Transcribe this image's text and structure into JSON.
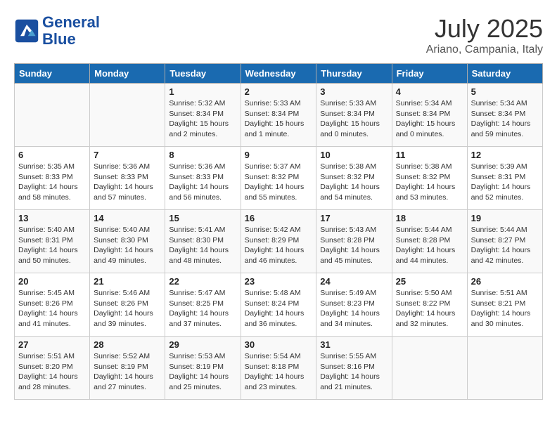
{
  "header": {
    "logo_line1": "General",
    "logo_line2": "Blue",
    "month": "July 2025",
    "location": "Ariano, Campania, Italy"
  },
  "days_of_week": [
    "Sunday",
    "Monday",
    "Tuesday",
    "Wednesday",
    "Thursday",
    "Friday",
    "Saturday"
  ],
  "weeks": [
    [
      {
        "day": "",
        "sunrise": "",
        "sunset": "",
        "daylight": ""
      },
      {
        "day": "",
        "sunrise": "",
        "sunset": "",
        "daylight": ""
      },
      {
        "day": "1",
        "sunrise": "Sunrise: 5:32 AM",
        "sunset": "Sunset: 8:34 PM",
        "daylight": "Daylight: 15 hours and 2 minutes."
      },
      {
        "day": "2",
        "sunrise": "Sunrise: 5:33 AM",
        "sunset": "Sunset: 8:34 PM",
        "daylight": "Daylight: 15 hours and 1 minute."
      },
      {
        "day": "3",
        "sunrise": "Sunrise: 5:33 AM",
        "sunset": "Sunset: 8:34 PM",
        "daylight": "Daylight: 15 hours and 0 minutes."
      },
      {
        "day": "4",
        "sunrise": "Sunrise: 5:34 AM",
        "sunset": "Sunset: 8:34 PM",
        "daylight": "Daylight: 15 hours and 0 minutes."
      },
      {
        "day": "5",
        "sunrise": "Sunrise: 5:34 AM",
        "sunset": "Sunset: 8:34 PM",
        "daylight": "Daylight: 14 hours and 59 minutes."
      }
    ],
    [
      {
        "day": "6",
        "sunrise": "Sunrise: 5:35 AM",
        "sunset": "Sunset: 8:33 PM",
        "daylight": "Daylight: 14 hours and 58 minutes."
      },
      {
        "day": "7",
        "sunrise": "Sunrise: 5:36 AM",
        "sunset": "Sunset: 8:33 PM",
        "daylight": "Daylight: 14 hours and 57 minutes."
      },
      {
        "day": "8",
        "sunrise": "Sunrise: 5:36 AM",
        "sunset": "Sunset: 8:33 PM",
        "daylight": "Daylight: 14 hours and 56 minutes."
      },
      {
        "day": "9",
        "sunrise": "Sunrise: 5:37 AM",
        "sunset": "Sunset: 8:32 PM",
        "daylight": "Daylight: 14 hours and 55 minutes."
      },
      {
        "day": "10",
        "sunrise": "Sunrise: 5:38 AM",
        "sunset": "Sunset: 8:32 PM",
        "daylight": "Daylight: 14 hours and 54 minutes."
      },
      {
        "day": "11",
        "sunrise": "Sunrise: 5:38 AM",
        "sunset": "Sunset: 8:32 PM",
        "daylight": "Daylight: 14 hours and 53 minutes."
      },
      {
        "day": "12",
        "sunrise": "Sunrise: 5:39 AM",
        "sunset": "Sunset: 8:31 PM",
        "daylight": "Daylight: 14 hours and 52 minutes."
      }
    ],
    [
      {
        "day": "13",
        "sunrise": "Sunrise: 5:40 AM",
        "sunset": "Sunset: 8:31 PM",
        "daylight": "Daylight: 14 hours and 50 minutes."
      },
      {
        "day": "14",
        "sunrise": "Sunrise: 5:40 AM",
        "sunset": "Sunset: 8:30 PM",
        "daylight": "Daylight: 14 hours and 49 minutes."
      },
      {
        "day": "15",
        "sunrise": "Sunrise: 5:41 AM",
        "sunset": "Sunset: 8:30 PM",
        "daylight": "Daylight: 14 hours and 48 minutes."
      },
      {
        "day": "16",
        "sunrise": "Sunrise: 5:42 AM",
        "sunset": "Sunset: 8:29 PM",
        "daylight": "Daylight: 14 hours and 46 minutes."
      },
      {
        "day": "17",
        "sunrise": "Sunrise: 5:43 AM",
        "sunset": "Sunset: 8:28 PM",
        "daylight": "Daylight: 14 hours and 45 minutes."
      },
      {
        "day": "18",
        "sunrise": "Sunrise: 5:44 AM",
        "sunset": "Sunset: 8:28 PM",
        "daylight": "Daylight: 14 hours and 44 minutes."
      },
      {
        "day": "19",
        "sunrise": "Sunrise: 5:44 AM",
        "sunset": "Sunset: 8:27 PM",
        "daylight": "Daylight: 14 hours and 42 minutes."
      }
    ],
    [
      {
        "day": "20",
        "sunrise": "Sunrise: 5:45 AM",
        "sunset": "Sunset: 8:26 PM",
        "daylight": "Daylight: 14 hours and 41 minutes."
      },
      {
        "day": "21",
        "sunrise": "Sunrise: 5:46 AM",
        "sunset": "Sunset: 8:26 PM",
        "daylight": "Daylight: 14 hours and 39 minutes."
      },
      {
        "day": "22",
        "sunrise": "Sunrise: 5:47 AM",
        "sunset": "Sunset: 8:25 PM",
        "daylight": "Daylight: 14 hours and 37 minutes."
      },
      {
        "day": "23",
        "sunrise": "Sunrise: 5:48 AM",
        "sunset": "Sunset: 8:24 PM",
        "daylight": "Daylight: 14 hours and 36 minutes."
      },
      {
        "day": "24",
        "sunrise": "Sunrise: 5:49 AM",
        "sunset": "Sunset: 8:23 PM",
        "daylight": "Daylight: 14 hours and 34 minutes."
      },
      {
        "day": "25",
        "sunrise": "Sunrise: 5:50 AM",
        "sunset": "Sunset: 8:22 PM",
        "daylight": "Daylight: 14 hours and 32 minutes."
      },
      {
        "day": "26",
        "sunrise": "Sunrise: 5:51 AM",
        "sunset": "Sunset: 8:21 PM",
        "daylight": "Daylight: 14 hours and 30 minutes."
      }
    ],
    [
      {
        "day": "27",
        "sunrise": "Sunrise: 5:51 AM",
        "sunset": "Sunset: 8:20 PM",
        "daylight": "Daylight: 14 hours and 28 minutes."
      },
      {
        "day": "28",
        "sunrise": "Sunrise: 5:52 AM",
        "sunset": "Sunset: 8:19 PM",
        "daylight": "Daylight: 14 hours and 27 minutes."
      },
      {
        "day": "29",
        "sunrise": "Sunrise: 5:53 AM",
        "sunset": "Sunset: 8:19 PM",
        "daylight": "Daylight: 14 hours and 25 minutes."
      },
      {
        "day": "30",
        "sunrise": "Sunrise: 5:54 AM",
        "sunset": "Sunset: 8:18 PM",
        "daylight": "Daylight: 14 hours and 23 minutes."
      },
      {
        "day": "31",
        "sunrise": "Sunrise: 5:55 AM",
        "sunset": "Sunset: 8:16 PM",
        "daylight": "Daylight: 14 hours and 21 minutes."
      },
      {
        "day": "",
        "sunrise": "",
        "sunset": "",
        "daylight": ""
      },
      {
        "day": "",
        "sunrise": "",
        "sunset": "",
        "daylight": ""
      }
    ]
  ]
}
